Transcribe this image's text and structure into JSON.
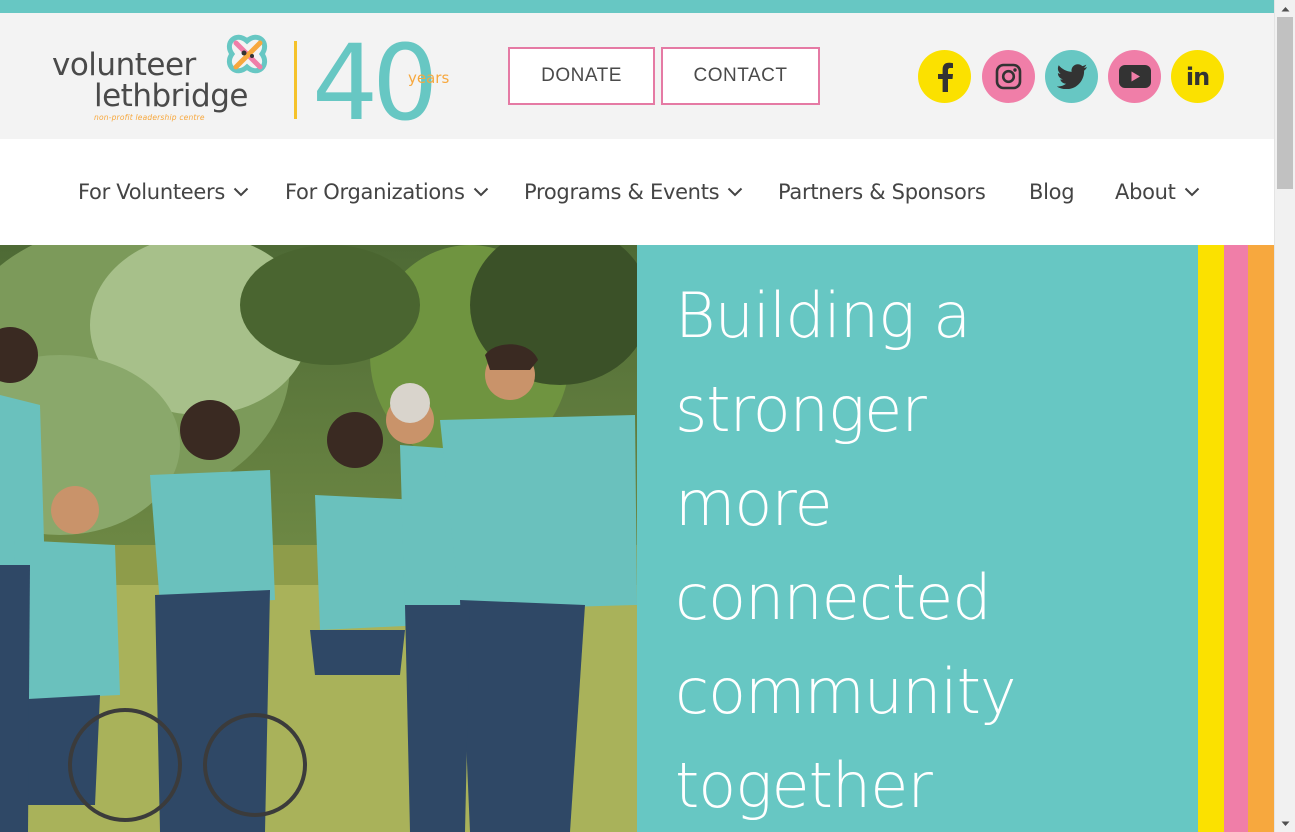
{
  "logo": {
    "line1": "volunteer",
    "line2": "lethbridge",
    "tagline": "non-profit leadership centre",
    "anniversary_number": "40",
    "anniversary_unit": "years",
    "icon": "knot-logo-icon"
  },
  "header": {
    "donate_label": "DONATE",
    "contact_label": "CONTACT",
    "social": [
      {
        "name": "facebook",
        "icon": "facebook-icon",
        "color": "#fbe100"
      },
      {
        "name": "instagram",
        "icon": "instagram-icon",
        "color": "#f07ea8"
      },
      {
        "name": "twitter",
        "icon": "twitter-icon",
        "color": "#67c7c3"
      },
      {
        "name": "youtube",
        "icon": "youtube-icon",
        "color": "#f07ea8"
      },
      {
        "name": "linkedin",
        "icon": "linkedin-icon",
        "label": "in",
        "color": "#fbe100"
      }
    ]
  },
  "nav": {
    "items": [
      {
        "label": "For Volunteers",
        "has_dropdown": true
      },
      {
        "label": "For Organizations",
        "has_dropdown": true
      },
      {
        "label": "Programs & Events",
        "has_dropdown": true
      },
      {
        "label": "Partners & Sponsors",
        "has_dropdown": false
      },
      {
        "label": "Blog",
        "has_dropdown": false
      },
      {
        "label": "About",
        "has_dropdown": true
      }
    ]
  },
  "hero": {
    "headline_lines": [
      "Building a",
      "stronger",
      "more",
      "connected",
      "community",
      "together"
    ],
    "photo": "volunteers-in-park-photo"
  },
  "colors": {
    "teal": "#67c7c3",
    "yellow": "#fbe100",
    "pink": "#f07ea8",
    "orange": "#f7a83e",
    "text": "#444444"
  }
}
